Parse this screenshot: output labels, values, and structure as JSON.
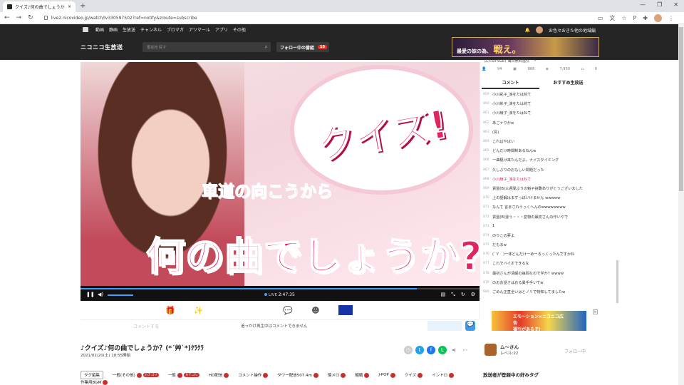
{
  "browser": {
    "tab_title": "クイズ♪何の曲でしょうか？(",
    "url": "live2.nicovideo.jp/watch/lv330597502?ref=notify&zroute=subscribe"
  },
  "topnav": {
    "items": [
      "動画",
      "静画",
      "生放送",
      "チャンネル",
      "ブロマガ",
      "アツマール",
      "アプリ",
      "その他"
    ],
    "user": "お色々おきた他の地域編"
  },
  "header": {
    "logo": "ニコニコ生放送",
    "search_placeholder": "番組を探す",
    "follow_label": "フォロー中の番組",
    "follow_count": "10",
    "ad_text": "最愛の妹の為、",
    "ad_big": "戦え。"
  },
  "video": {
    "quiz": "クイズ!",
    "subtitle": "車道の向こうから",
    "question": "何の曲でしょうか?",
    "live_label": "LIVE",
    "time": "2:47:35",
    "progress": 0.843
  },
  "comment_input": {
    "placeholder": "コメントする",
    "note": "追っかけ再生中はコメントできません"
  },
  "program": {
    "title": "♪クイズ♪何の曲でしょうか？(*´艸`*)ｸﾗｸﾗ",
    "date": "2021/02/20(土) 18:55開始"
  },
  "user": {
    "name": "ム〜さん",
    "level": "レベル:22",
    "follow": "フォロー中"
  },
  "tags": {
    "edit": "タグ編集",
    "items": [
      {
        "label": "一般(その他)",
        "badge": "カテゴリ"
      },
      {
        "label": "一般",
        "badge": "カテゴリ"
      },
      {
        "label": "HD配信",
        "badge": ""
      },
      {
        "label": "コメント操作",
        "badge": ""
      },
      {
        "label": "タワー配信507.4m",
        "badge": ""
      },
      {
        "label": "懐メロ",
        "badge": ""
      },
      {
        "label": "鯖鯖",
        "badge": ""
      },
      {
        "label": "J-POP",
        "badge": ""
      },
      {
        "label": "クイズ",
        "badge": ""
      },
      {
        "label": "イントロ",
        "badge": ""
      },
      {
        "label": "作業用BGM",
        "badge": ""
      }
    ],
    "recommend_title": "放送者が登録中の好みタグ"
  },
  "side": {
    "banner": "広人50%GET 毎日無料福引",
    "stats": [
      "94",
      "868",
      "7,950",
      "0"
    ],
    "tab_comment": "コメント",
    "tab_recommend": "おすすめ生放送",
    "comments": [
      {
        "no": "859",
        "text": "小川彩子_涙をたは約て",
        "hl": false
      },
      {
        "no": "860",
        "text": "小川彩子_涙をたは約て",
        "hl": false
      },
      {
        "no": "861",
        "text": "小川綾子_涙をたはねて",
        "hl": false
      },
      {
        "no": "862",
        "text": "あごナりかw",
        "hl": false
      },
      {
        "no": "863",
        "text": "(鳥)",
        "hl": false
      },
      {
        "no": "864",
        "text": "これはやばい",
        "hl": false
      },
      {
        "no": "865",
        "text": "どんだけ時間制あるねんw",
        "hl": false
      },
      {
        "no": "866",
        "text": "一曲駆け来たんだよ。ナイスタイミング",
        "hl": false
      },
      {
        "no": "867",
        "text": "久しぶりのおもしい問題だった",
        "hl": false
      },
      {
        "no": "868",
        "text": "小川綾子_涙をたはねて",
        "hl": true
      },
      {
        "no": "869",
        "text": "貢盤(B)三週間ぶりの魁子詩難ありがとうございました",
        "hl": false
      },
      {
        "no": "870",
        "text": "上の語解はまずっぽいけません wwwww",
        "hl": false
      },
      {
        "no": "871",
        "text": "なんて 言まされうっくへんのwwwwwwww",
        "hl": false
      },
      {
        "no": "872",
        "text": "貢盤(B)違う・・・変物の最初さんの作いやで",
        "hl": false
      },
      {
        "no": "873",
        "text": "1",
        "hl": false
      },
      {
        "no": "874",
        "text": "のりこの夢よ",
        "hl": false
      },
      {
        "no": "875",
        "text": "だもまw",
        "hl": false
      },
      {
        "no": "876",
        "text": "(´Ｙ｀)一体どんだけーめーるっくったんですかね",
        "hl": false
      },
      {
        "no": "877",
        "text": "これでバイオできるな",
        "hl": false
      },
      {
        "no": "878",
        "text": "最初さんが清解の毎問なので学か？wwww",
        "hl": false
      },
      {
        "no": "879",
        "text": "のおお話さはおる異手手いてw",
        "hl": false
      },
      {
        "no": "880",
        "text": "ごめん正直全いはとノリで物知してましたw",
        "hl": false
      }
    ],
    "ad_text": "エモーション×ニコニコ広告",
    "ad_big": "福引があるぞ!"
  },
  "colors": {
    "accent": "#e0245e",
    "blue": "#3da0ff",
    "dark": "#252525"
  }
}
